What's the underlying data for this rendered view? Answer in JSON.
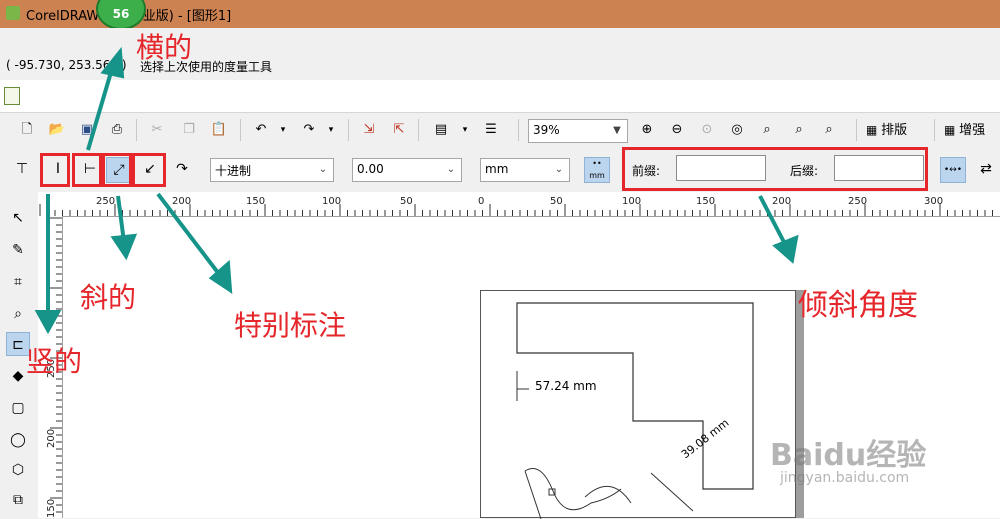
{
  "window": {
    "title": "CorelDRAW X7 (专业版) - [图形1]",
    "step_badge": "56"
  },
  "status": {
    "coords": "( -95.730, 253.569 )",
    "hint": "选择上次使用的度量工具"
  },
  "toolbar": {
    "zoom_value": "39%",
    "layout_label": "排版",
    "enhance_label": "增强"
  },
  "property_bar": {
    "units_format": "十进制",
    "precision": "0.00",
    "unit": "mm",
    "prefix_label": "前缀:",
    "prefix_value": "",
    "suffix_label": "后缀:",
    "suffix_value": ""
  },
  "ruler": {
    "h_labels": [
      "250",
      "200",
      "150",
      "100",
      "50",
      "0",
      "50",
      "100",
      "150",
      "200",
      "250",
      "300"
    ],
    "v_labels": [
      "250",
      "200",
      "150"
    ]
  },
  "drawing": {
    "dim1": "57.24 mm",
    "dim2": "39.08 mm"
  },
  "annotations": {
    "horizontal": "横的",
    "diagonal": "斜的",
    "special": "特别标注",
    "vertical": "竖的",
    "tilt_angle": "倾斜角度"
  },
  "watermark": {
    "brand": "Baidu经验",
    "url": "jingyan.baidu.com"
  },
  "colors": {
    "titlebar": "#cd8251",
    "highlight_box": "#e5262b",
    "arrow": "#16948a"
  }
}
